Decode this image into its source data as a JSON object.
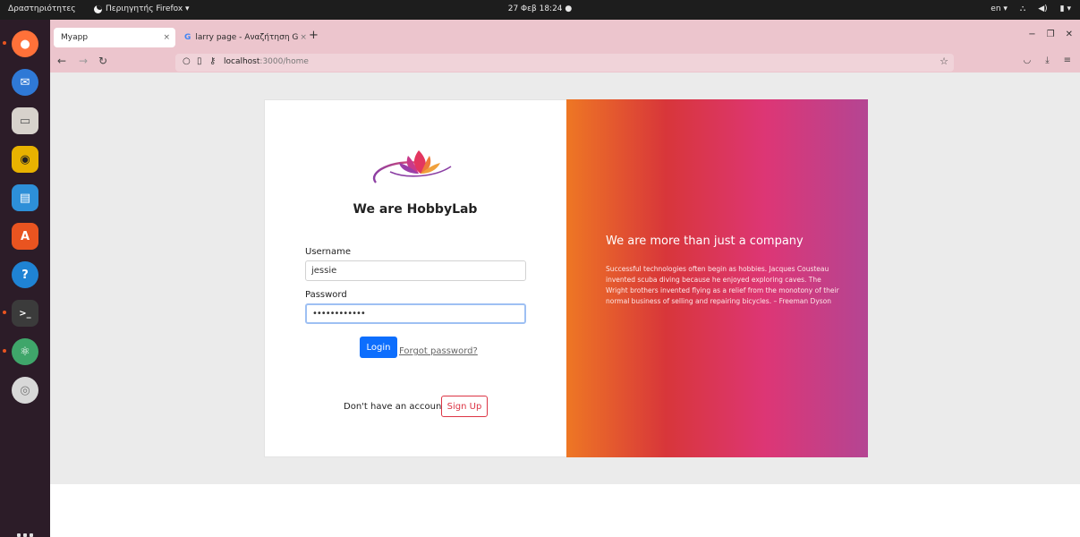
{
  "topbar": {
    "activities": "Δραστηριότητες",
    "app_menu": "Περιηγητής Firefox ▾",
    "clock": "27 Φεβ 18:24",
    "lang": "en ▾"
  },
  "dock": {
    "items": [
      {
        "name": "firefox-icon",
        "color": "#ff7139"
      },
      {
        "name": "thunderbird-icon",
        "color": "#2f79d6"
      },
      {
        "name": "files-icon",
        "color": "#d7d2cc"
      },
      {
        "name": "rhythmbox-icon",
        "color": "#e8b200"
      },
      {
        "name": "libreoffice-writer-icon",
        "color": "#2d8fd8"
      },
      {
        "name": "app-center-icon",
        "color": "#e95420"
      },
      {
        "name": "help-icon",
        "color": "#1f83d4"
      },
      {
        "name": "terminal-icon",
        "color": "#3b3b3b"
      },
      {
        "name": "atom-icon",
        "color": "#3fa66a"
      },
      {
        "name": "disc-icon",
        "color": "#d8d8d8"
      }
    ]
  },
  "browser": {
    "tabs": [
      {
        "label": "Myapp",
        "close": "×"
      },
      {
        "label": "larry page - Αναζήτηση G",
        "close": "×"
      }
    ],
    "new_tab": "+",
    "url_host": "localhost",
    "url_path": ":3000/home"
  },
  "login": {
    "headline": "We are HobbyLab",
    "username_label": "Username",
    "username_value": "jessie",
    "password_label": "Password",
    "password_value": "••••••••••••",
    "login_button": "Login",
    "forgot_link": "Forgot password?",
    "no_account_text": "Don't have an account?",
    "signup_button": "Sign Up"
  },
  "promo": {
    "title": "We are more than just a company",
    "text": "Successful technologies often begin as hobbies. Jacques Cousteau invented scuba diving because he enjoyed exploring caves. The Wright brothers invented flying as a relief from the monotony of their normal business of selling and repairing bicycles. – Freeman Dyson"
  },
  "colors": {
    "primary": "#0d6efd",
    "danger": "#dc3545",
    "gradient": [
      "#ee7724",
      "#d8363a",
      "#dd3675",
      "#b44593"
    ]
  }
}
